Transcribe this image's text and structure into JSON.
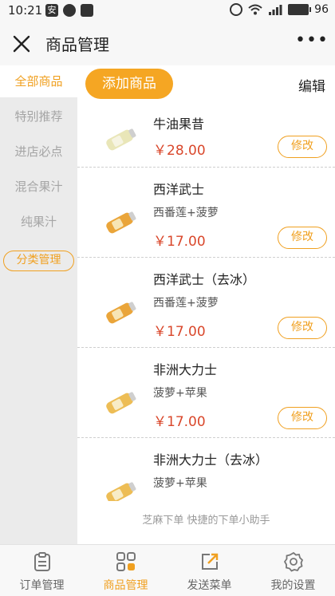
{
  "status_bar": {
    "time": "10:21",
    "left_icons": [
      "安",
      "ring-icon",
      "mail-icon"
    ],
    "battery_pct": "96"
  },
  "header": {
    "title": "商品管理",
    "more_glyph": "•••"
  },
  "sidebar": {
    "items": [
      {
        "label": "全部商品",
        "active": true
      },
      {
        "label": "特别推荐",
        "active": false
      },
      {
        "label": "进店必点",
        "active": false
      },
      {
        "label": "混合果汁",
        "active": false
      },
      {
        "label": "纯果汁",
        "active": false
      }
    ],
    "manage_label": "分类管理"
  },
  "actions": {
    "add_label": "添加商品",
    "edit_label": "编辑"
  },
  "products": [
    {
      "name": "牛油果昔",
      "desc": "",
      "price": "￥28.00",
      "modify": "修改"
    },
    {
      "name": "西洋武士",
      "desc": "西番莲+菠萝",
      "price": "￥17.00",
      "modify": "修改"
    },
    {
      "name": "西洋武士（去冰）",
      "desc": "西番莲+菠萝",
      "price": "￥17.00",
      "modify": "修改"
    },
    {
      "name": "非洲大力士",
      "desc": "菠萝+苹果",
      "price": "￥17.00",
      "modify": "修改"
    },
    {
      "name": "非洲大力士（去冰）",
      "desc": "菠萝+苹果",
      "price": "",
      "modify": ""
    }
  ],
  "footer_tip": "芝麻下单 快捷的下单小助手",
  "bottom_nav": [
    {
      "label": "订单管理",
      "icon": "clipboard-icon",
      "active": false
    },
    {
      "label": "商品管理",
      "icon": "grid-icon",
      "active": true
    },
    {
      "label": "发送菜单",
      "icon": "share-arrow-icon",
      "active": false
    },
    {
      "label": "我的设置",
      "icon": "gear-icon",
      "active": false
    }
  ],
  "colors": {
    "accent": "#f0a020",
    "accent_fill": "#f5a623",
    "price": "#d9472b",
    "sidebar_bg": "#ebebeb"
  }
}
